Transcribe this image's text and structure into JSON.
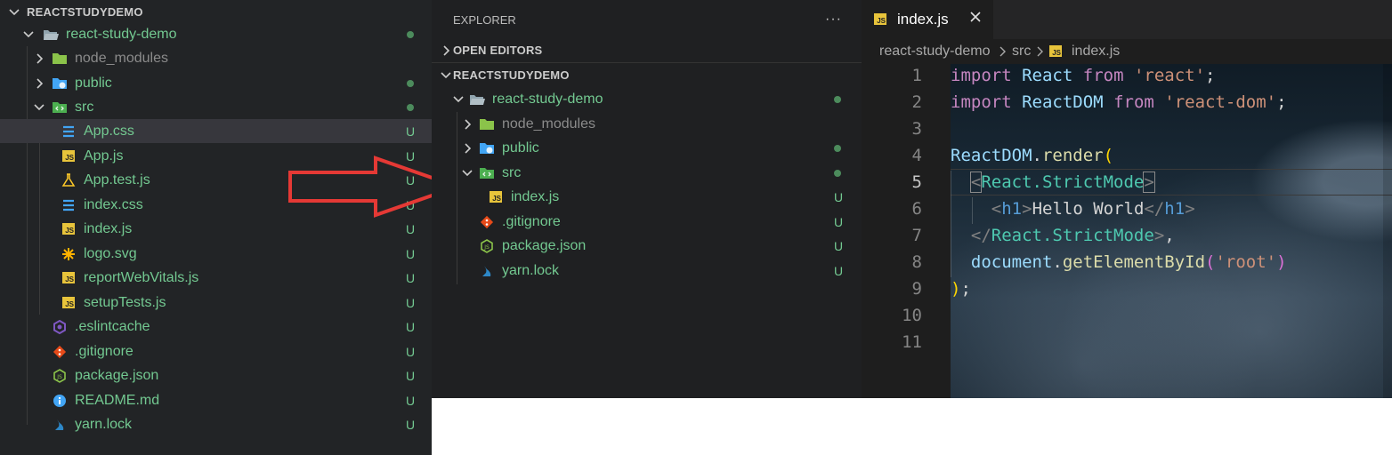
{
  "left_tree": {
    "root_label": "REACTSTUDYDEMO",
    "project_folder": "react-study-demo",
    "items": [
      {
        "label": "node_modules",
        "status": ""
      },
      {
        "label": "public",
        "status": ""
      },
      {
        "label": "src",
        "status": ""
      },
      {
        "label": "App.css",
        "status": "U"
      },
      {
        "label": "App.js",
        "status": "U"
      },
      {
        "label": "App.test.js",
        "status": "U"
      },
      {
        "label": "index.css",
        "status": "U"
      },
      {
        "label": "index.js",
        "status": "U"
      },
      {
        "label": "logo.svg",
        "status": "U"
      },
      {
        "label": "reportWebVitals.js",
        "status": "U"
      },
      {
        "label": "setupTests.js",
        "status": "U"
      },
      {
        "label": ".eslintcache",
        "status": "U"
      },
      {
        "label": ".gitignore",
        "status": "U"
      },
      {
        "label": "package.json",
        "status": "U"
      },
      {
        "label": "README.md",
        "status": "U"
      },
      {
        "label": "yarn.lock",
        "status": "U"
      }
    ]
  },
  "mid_tree": {
    "explorer_title": "EXPLORER",
    "more_actions": "···",
    "open_editors_label": "OPEN EDITORS",
    "root_label": "REACTSTUDYDEMO",
    "project_folder": "react-study-demo",
    "items": [
      {
        "label": "node_modules",
        "status": ""
      },
      {
        "label": "public",
        "status": ""
      },
      {
        "label": "src",
        "status": ""
      },
      {
        "label": "index.js",
        "status": "U"
      },
      {
        "label": ".gitignore",
        "status": "U"
      },
      {
        "label": "package.json",
        "status": "U"
      },
      {
        "label": "yarn.lock",
        "status": "U"
      }
    ]
  },
  "editor": {
    "tab_label": "index.js",
    "tab_icon_text": "JS",
    "breadcrumb": [
      "react-study-demo",
      "src",
      "index.js"
    ],
    "line_numbers": [
      "1",
      "2",
      "3",
      "4",
      "5",
      "6",
      "7",
      "8",
      "9",
      "10",
      "11"
    ],
    "current_line": "5",
    "code_tokens": {
      "import": "import",
      "from": "from",
      "react_id": "React",
      "react_str": "'react'",
      "reactdom_id": "ReactDOM",
      "reactdom_str": "'react-dom'",
      "semicolon": ";",
      "render_obj": "ReactDOM",
      "dot": ".",
      "render_fn": "render",
      "open_paren": "(",
      "lt": "<",
      "gt": ">",
      "lt_slash": "</",
      "strict_tag": "React.StrictMode",
      "h1_tag": "h1",
      "hello": "Hello World",
      "comma": ",",
      "document": "document",
      "get_fn": "getElementById",
      "root_str": "'root'",
      "close_paren": ")",
      "close_stmt": ");"
    }
  },
  "colors": {
    "untracked": "#73c991",
    "arrow": "#e53935"
  }
}
